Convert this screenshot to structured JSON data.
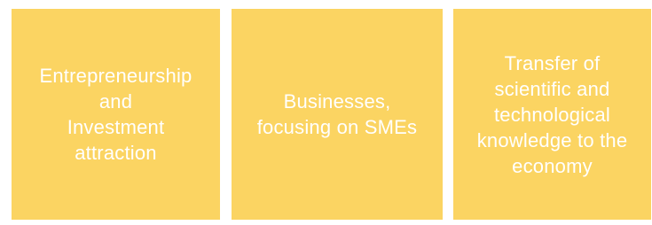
{
  "boxes": [
    {
      "text": "Entrepreneurship\nand\nInvestment\nattraction"
    },
    {
      "text": "Businesses,\nfocusing on SMEs"
    },
    {
      "text": "Transfer of\nscientific and\ntechnological\nknowledge to the\neconomy"
    }
  ],
  "colors": {
    "box_fill": "#fbd462",
    "box_text": "#ffffff",
    "background": "#ffffff"
  }
}
